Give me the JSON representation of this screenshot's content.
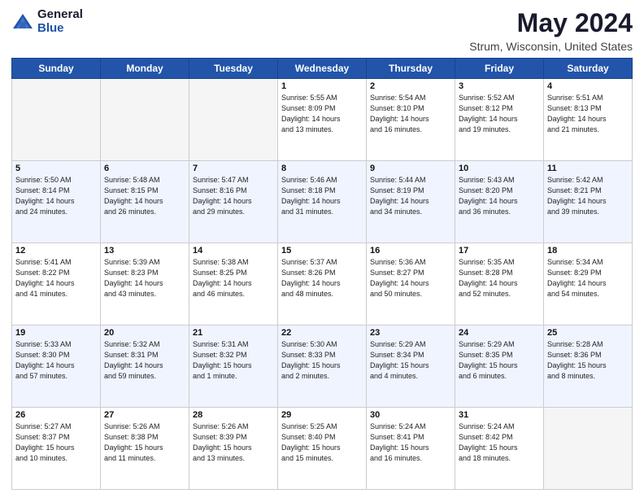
{
  "logo": {
    "general": "General",
    "blue": "Blue"
  },
  "title": "May 2024",
  "location": "Strum, Wisconsin, United States",
  "days_of_week": [
    "Sunday",
    "Monday",
    "Tuesday",
    "Wednesday",
    "Thursday",
    "Friday",
    "Saturday"
  ],
  "weeks": [
    [
      {
        "day": "",
        "info": ""
      },
      {
        "day": "",
        "info": ""
      },
      {
        "day": "",
        "info": ""
      },
      {
        "day": "1",
        "info": "Sunrise: 5:55 AM\nSunset: 8:09 PM\nDaylight: 14 hours\nand 13 minutes."
      },
      {
        "day": "2",
        "info": "Sunrise: 5:54 AM\nSunset: 8:10 PM\nDaylight: 14 hours\nand 16 minutes."
      },
      {
        "day": "3",
        "info": "Sunrise: 5:52 AM\nSunset: 8:12 PM\nDaylight: 14 hours\nand 19 minutes."
      },
      {
        "day": "4",
        "info": "Sunrise: 5:51 AM\nSunset: 8:13 PM\nDaylight: 14 hours\nand 21 minutes."
      }
    ],
    [
      {
        "day": "5",
        "info": "Sunrise: 5:50 AM\nSunset: 8:14 PM\nDaylight: 14 hours\nand 24 minutes."
      },
      {
        "day": "6",
        "info": "Sunrise: 5:48 AM\nSunset: 8:15 PM\nDaylight: 14 hours\nand 26 minutes."
      },
      {
        "day": "7",
        "info": "Sunrise: 5:47 AM\nSunset: 8:16 PM\nDaylight: 14 hours\nand 29 minutes."
      },
      {
        "day": "8",
        "info": "Sunrise: 5:46 AM\nSunset: 8:18 PM\nDaylight: 14 hours\nand 31 minutes."
      },
      {
        "day": "9",
        "info": "Sunrise: 5:44 AM\nSunset: 8:19 PM\nDaylight: 14 hours\nand 34 minutes."
      },
      {
        "day": "10",
        "info": "Sunrise: 5:43 AM\nSunset: 8:20 PM\nDaylight: 14 hours\nand 36 minutes."
      },
      {
        "day": "11",
        "info": "Sunrise: 5:42 AM\nSunset: 8:21 PM\nDaylight: 14 hours\nand 39 minutes."
      }
    ],
    [
      {
        "day": "12",
        "info": "Sunrise: 5:41 AM\nSunset: 8:22 PM\nDaylight: 14 hours\nand 41 minutes."
      },
      {
        "day": "13",
        "info": "Sunrise: 5:39 AM\nSunset: 8:23 PM\nDaylight: 14 hours\nand 43 minutes."
      },
      {
        "day": "14",
        "info": "Sunrise: 5:38 AM\nSunset: 8:25 PM\nDaylight: 14 hours\nand 46 minutes."
      },
      {
        "day": "15",
        "info": "Sunrise: 5:37 AM\nSunset: 8:26 PM\nDaylight: 14 hours\nand 48 minutes."
      },
      {
        "day": "16",
        "info": "Sunrise: 5:36 AM\nSunset: 8:27 PM\nDaylight: 14 hours\nand 50 minutes."
      },
      {
        "day": "17",
        "info": "Sunrise: 5:35 AM\nSunset: 8:28 PM\nDaylight: 14 hours\nand 52 minutes."
      },
      {
        "day": "18",
        "info": "Sunrise: 5:34 AM\nSunset: 8:29 PM\nDaylight: 14 hours\nand 54 minutes."
      }
    ],
    [
      {
        "day": "19",
        "info": "Sunrise: 5:33 AM\nSunset: 8:30 PM\nDaylight: 14 hours\nand 57 minutes."
      },
      {
        "day": "20",
        "info": "Sunrise: 5:32 AM\nSunset: 8:31 PM\nDaylight: 14 hours\nand 59 minutes."
      },
      {
        "day": "21",
        "info": "Sunrise: 5:31 AM\nSunset: 8:32 PM\nDaylight: 15 hours\nand 1 minute."
      },
      {
        "day": "22",
        "info": "Sunrise: 5:30 AM\nSunset: 8:33 PM\nDaylight: 15 hours\nand 2 minutes."
      },
      {
        "day": "23",
        "info": "Sunrise: 5:29 AM\nSunset: 8:34 PM\nDaylight: 15 hours\nand 4 minutes."
      },
      {
        "day": "24",
        "info": "Sunrise: 5:29 AM\nSunset: 8:35 PM\nDaylight: 15 hours\nand 6 minutes."
      },
      {
        "day": "25",
        "info": "Sunrise: 5:28 AM\nSunset: 8:36 PM\nDaylight: 15 hours\nand 8 minutes."
      }
    ],
    [
      {
        "day": "26",
        "info": "Sunrise: 5:27 AM\nSunset: 8:37 PM\nDaylight: 15 hours\nand 10 minutes."
      },
      {
        "day": "27",
        "info": "Sunrise: 5:26 AM\nSunset: 8:38 PM\nDaylight: 15 hours\nand 11 minutes."
      },
      {
        "day": "28",
        "info": "Sunrise: 5:26 AM\nSunset: 8:39 PM\nDaylight: 15 hours\nand 13 minutes."
      },
      {
        "day": "29",
        "info": "Sunrise: 5:25 AM\nSunset: 8:40 PM\nDaylight: 15 hours\nand 15 minutes."
      },
      {
        "day": "30",
        "info": "Sunrise: 5:24 AM\nSunset: 8:41 PM\nDaylight: 15 hours\nand 16 minutes."
      },
      {
        "day": "31",
        "info": "Sunrise: 5:24 AM\nSunset: 8:42 PM\nDaylight: 15 hours\nand 18 minutes."
      },
      {
        "day": "",
        "info": ""
      }
    ]
  ]
}
